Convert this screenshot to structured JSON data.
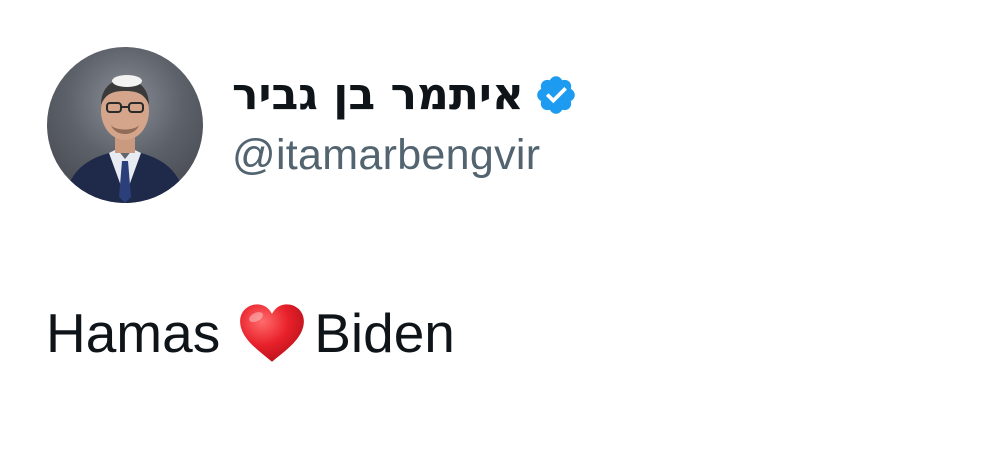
{
  "author": {
    "display_name": "איתמר בן גביר",
    "handle": "@itamarbengvir",
    "verified_icon": "verified-badge-icon",
    "avatar_icon": "profile-photo"
  },
  "tweet": {
    "text_before": "Hamas",
    "emoji": "heart-icon",
    "text_after": "Biden"
  },
  "colors": {
    "verified": "#1d9bf0",
    "handle": "#536471",
    "text": "#0f1419",
    "heart": "#e8202a"
  }
}
